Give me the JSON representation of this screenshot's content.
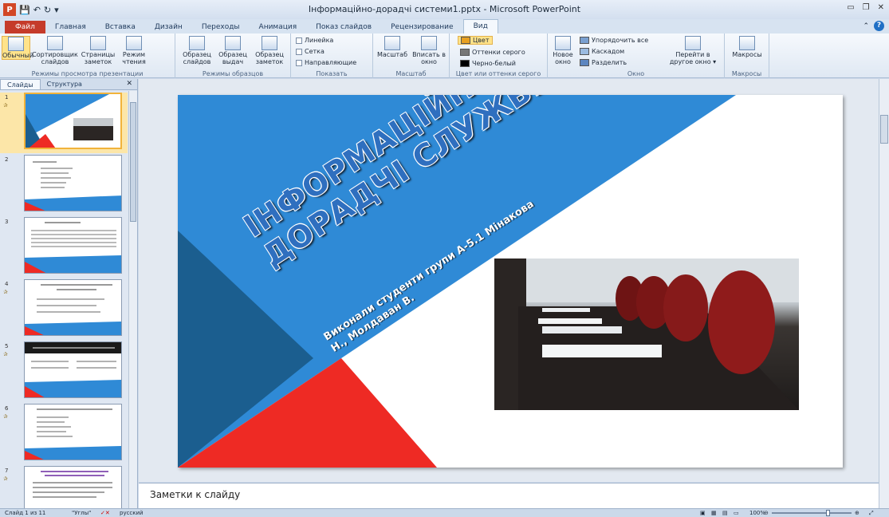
{
  "app": {
    "logo_letter": "P",
    "window_title": "Інформаційно-дорадчі системи1.pptx - Microsoft PowerPoint"
  },
  "tabs": [
    "Файл",
    "Главная",
    "Вставка",
    "Дизайн",
    "Переходы",
    "Анимация",
    "Показ слайдов",
    "Рецензирование",
    "Вид"
  ],
  "ribbon": {
    "groups": {
      "views": {
        "label": "Режимы просмотра презентации",
        "buttons": [
          "Обычный",
          "Сортировщик слайдов",
          "Страницы заметок",
          "Режим чтения"
        ]
      },
      "masters": {
        "label": "Режимы образцов",
        "buttons": [
          "Образец слайдов",
          "Образец выдач",
          "Образец заметок"
        ]
      },
      "show": {
        "label": "Показать",
        "checks": [
          "Линейка",
          "Сетка",
          "Направляющие"
        ]
      },
      "zoom": {
        "label": "Масштаб",
        "buttons": [
          "Масштаб",
          "Вписать в окно"
        ]
      },
      "color": {
        "label": "Цвет или оттенки серого",
        "items": [
          "Цвет",
          "Оттенки серого",
          "Черно-белый"
        ]
      },
      "window": {
        "label": "Окно",
        "new_window": "Новое окно",
        "items": [
          "Упорядочить все",
          "Каскадом",
          "Разделить"
        ],
        "switch": "Перейти в другое окно"
      },
      "macros": {
        "label": "Макросы",
        "button": "Макросы"
      }
    }
  },
  "left_pane": {
    "tabs": [
      "Слайды",
      "Структура"
    ],
    "slide_numbers": [
      "1",
      "2",
      "3",
      "4",
      "5",
      "6",
      "7"
    ]
  },
  "slide": {
    "title": "ІНФОРМАЦІЙНО-ДОРАДЧІ СЛУЖБИ",
    "subtitle": "Виконали студенти групи А-5.1 Мінакова Н., Молдаван В."
  },
  "notes": {
    "placeholder": "Заметки к слайду"
  },
  "status": {
    "slide_info": "Слайд 1 из 11",
    "theme": "\"Углы\"",
    "language": "русский",
    "zoom": "100%"
  },
  "colors": {
    "slide_blue": "#2f8ad6",
    "slide_dark_blue": "#1b5e8f",
    "slide_red": "#ee2a24",
    "file_tab": "#c53b2a"
  }
}
